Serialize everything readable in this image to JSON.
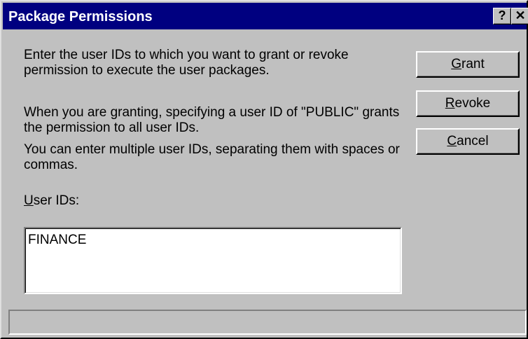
{
  "window": {
    "title": "Package Permissions",
    "help_glyph": "?",
    "close_glyph": "✕"
  },
  "text": {
    "para1": "Enter the user IDs to which you want to grant or revoke permission to execute the user packages.",
    "para2": "When you are granting, specifying a user ID of \"PUBLIC\" grants the permission to all user IDs.",
    "para3": "You can enter multiple user IDs, separating them with spaces or commas."
  },
  "user_ids": {
    "label_mnemonic": "U",
    "label_rest": "ser IDs:",
    "value": "FINANCE"
  },
  "buttons": {
    "grant_mnemonic": "G",
    "grant_rest": "rant",
    "revoke_mnemonic": "R",
    "revoke_rest": "evoke",
    "cancel_mnemonic": "C",
    "cancel_rest": "ancel"
  },
  "status": {
    "text": ""
  }
}
